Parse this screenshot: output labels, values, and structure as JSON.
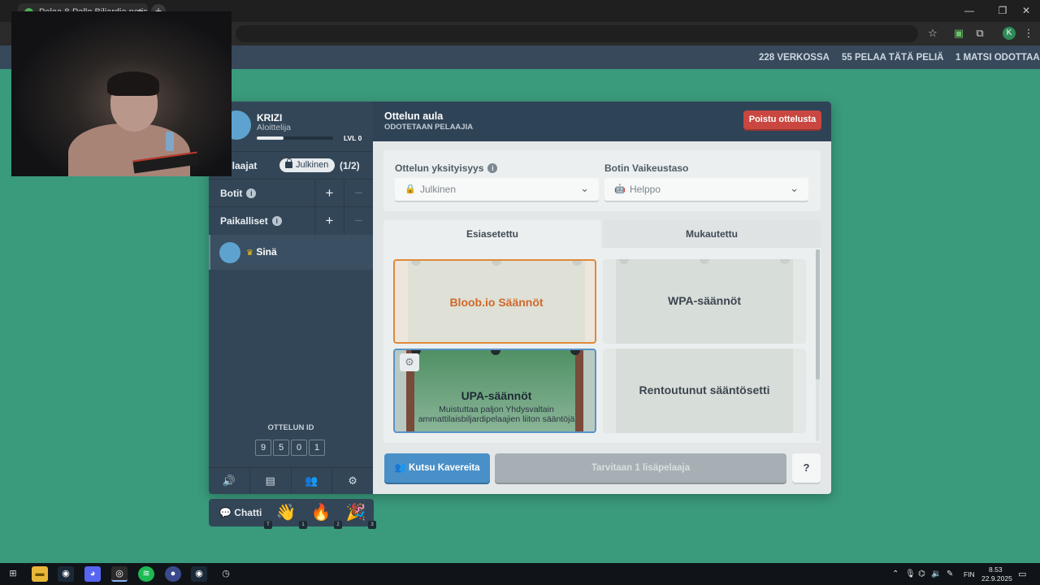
{
  "browser": {
    "tab_title": "Pelaa 8-Pallo Biljardia netissä! | bloob.io",
    "close_tab": "×",
    "new_tab": "+",
    "profile_initial": "K"
  },
  "site_header": {
    "online": "228 VERKOSSA",
    "playing": "55 PELAA TÄTÄ PELIÄ",
    "waiting": "1 MATSI ODOTTAA"
  },
  "profile": {
    "name": "KRIZI",
    "rank": "Aloittelija",
    "level": "LVL 0",
    "xp_progress": 0.35
  },
  "left_panel": {
    "players_label": "Pelaajat",
    "visibility_pill": "Julkinen",
    "player_count": "(1/2)",
    "bots_label": "Botit",
    "locals_label": "Paikalliset",
    "add_glyph": "+",
    "remove_glyph": "−",
    "info_glyph": "i",
    "current_player": "Sinä",
    "crown_glyph": "♛",
    "match_id_label": "OTTELUN ID",
    "match_id_digits": [
      "9",
      "5",
      "0",
      "1"
    ]
  },
  "right_panel": {
    "title": "Ottelun aula",
    "subtitle": "ODOTETAAN PELAAJIA",
    "leave_button": "Poistu ottelusta",
    "privacy_label": "Ottelun yksityisyys",
    "privacy_value": "Julkinen",
    "bot_label": "Botin Vaikeustaso",
    "bot_value": "Helppo",
    "tab_preset": "Esiasetettu",
    "tab_custom": "Mukautettu",
    "rules": [
      {
        "title": "Bloob.io Säännöt",
        "desc": ""
      },
      {
        "title": "WPA-säännöt",
        "desc": ""
      },
      {
        "title": "UPA-säännöt",
        "desc": "Muistuttaa paljon Yhdysvaltain ammattilaisbiljardipelaajien liiton sääntöjä"
      },
      {
        "title": "Rentoutunut sääntösetti",
        "desc": ""
      }
    ],
    "invite_button": "Kutsu Kavereita",
    "need_button": "Tarvitaan 1 lisäpelaaja",
    "help_button": "?"
  },
  "chat": {
    "label": "Chatti",
    "emojis": [
      "👋",
      "🔥",
      "🎉"
    ],
    "keys": [
      "T",
      "1",
      "2",
      "3"
    ]
  },
  "taskbar": {
    "lang": "FIN",
    "time": "8.53",
    "date": "22.9.2025"
  },
  "colors": {
    "background": "#3a9a7c",
    "panel": "#334657",
    "selected_rule": "#e08a3a",
    "leave": "#c94740",
    "invite": "#4a90c8"
  }
}
